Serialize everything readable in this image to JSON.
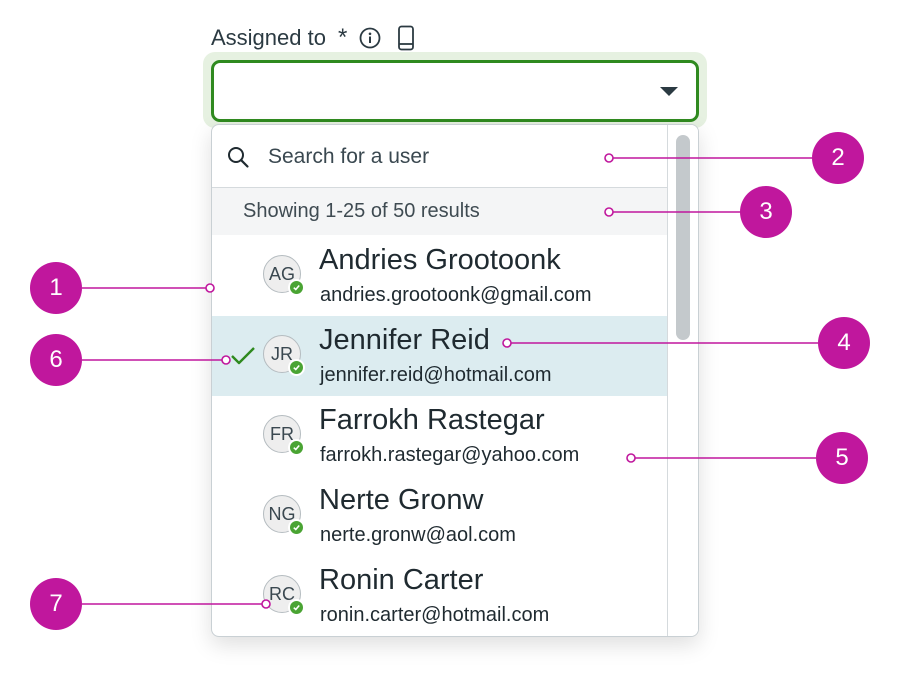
{
  "field": {
    "label": "Assigned to",
    "required_mark": "*",
    "info_icon": "info-circle-icon",
    "device_icon": "mobile-device-icon",
    "value": ""
  },
  "dropdown": {
    "search_placeholder": "Search for a user",
    "results_text": "Showing 1-25 of 50 results",
    "users": [
      {
        "initials": "AG",
        "name": "Andries Grootoonk",
        "email": "andries.grootoonk@gmail.com",
        "selected": false
      },
      {
        "initials": "JR",
        "name": "Jennifer Reid",
        "email": "jennifer.reid@hotmail.com",
        "selected": true
      },
      {
        "initials": "FR",
        "name": "Farrokh Rastegar",
        "email": "farrokh.rastegar@yahoo.com",
        "selected": false
      },
      {
        "initials": "NG",
        "name": "Nerte Gronw",
        "email": "nerte.gronw@aol.com",
        "selected": false
      },
      {
        "initials": "RC",
        "name": "Ronin Carter",
        "email": "ronin.carter@hotmail.com",
        "selected": false
      }
    ]
  },
  "callouts": [
    "1",
    "2",
    "3",
    "4",
    "5",
    "6",
    "7"
  ],
  "colors": {
    "focus_border": "#2f8a1f",
    "focus_halo": "#e6f1e1",
    "selected_row": "#dcecf0",
    "presence": "#4aa433",
    "callout": "#c0179d"
  }
}
